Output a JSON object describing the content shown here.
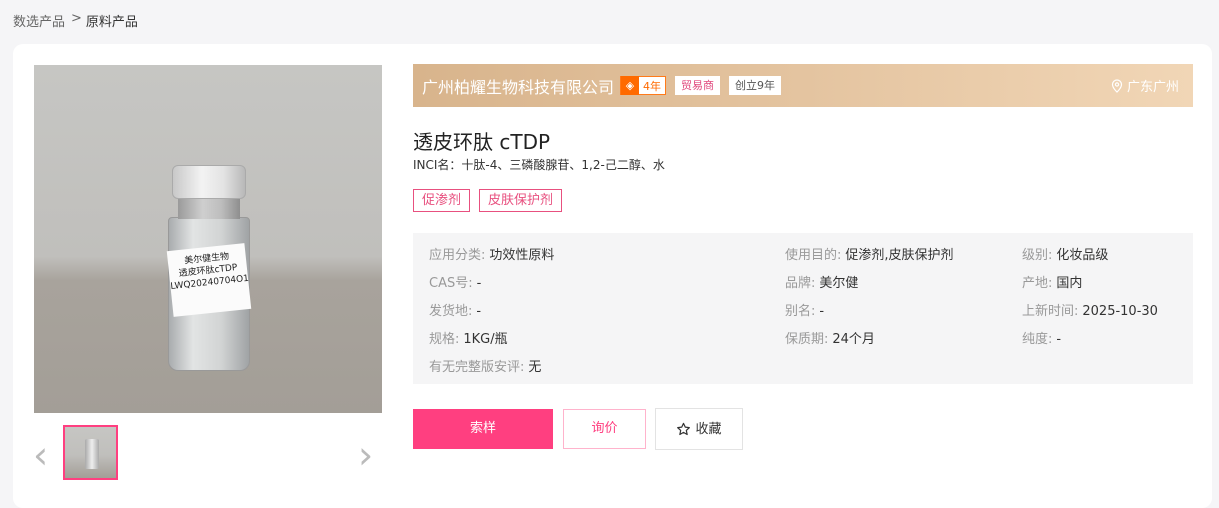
{
  "breadcrumb": {
    "root": "数选产品",
    "separator": ">",
    "current": "原料产品"
  },
  "image": {
    "label_line1": "美尔健生物",
    "label_line2": "透皮环肽cTDP",
    "label_line3": "LWQ20240704O1"
  },
  "supplier": {
    "name": "广州柏耀生物科技有限公司",
    "years_badge": "4年",
    "trade_badge": "贸易商",
    "founded_badge": "创立9年",
    "location": "广东广州"
  },
  "product": {
    "title": "透皮环肽 cTDP",
    "inci": "INCI名：十肽-4、三磷酸腺苷、1,2-己二醇、水",
    "tags": [
      "促渗剂",
      "皮肤保护剂"
    ]
  },
  "specs": {
    "category": {
      "k": "应用分类:",
      "v": "功效性原料"
    },
    "purpose": {
      "k": "使用目的:",
      "v": "促渗剂,皮肤保护剂"
    },
    "grade": {
      "k": "级别:",
      "v": "化妆品级"
    },
    "cas": {
      "k": "CAS号:",
      "v": "-"
    },
    "brand": {
      "k": "品牌:",
      "v": "美尔健"
    },
    "origin": {
      "k": "产地:",
      "v": "国内"
    },
    "ship_from": {
      "k": "发货地:",
      "v": "-"
    },
    "alias": {
      "k": "别名:",
      "v": "-"
    },
    "updated": {
      "k": "上新时间:",
      "v": "2025-10-30"
    },
    "spec": {
      "k": "规格:",
      "v": "1KG/瓶"
    },
    "shelf_life": {
      "k": "保质期:",
      "v": "24个月"
    },
    "purity": {
      "k": "纯度:",
      "v": "-"
    },
    "safety_report": {
      "k": "有无完整版安评:",
      "v": "无"
    }
  },
  "actions": {
    "sample": "索样",
    "inquiry": "询价",
    "favorite": "收藏"
  },
  "colors": {
    "accent": "#ff3f80",
    "supplier_bar": "#e4c4a0",
    "year_badge": "#ff6a00"
  }
}
